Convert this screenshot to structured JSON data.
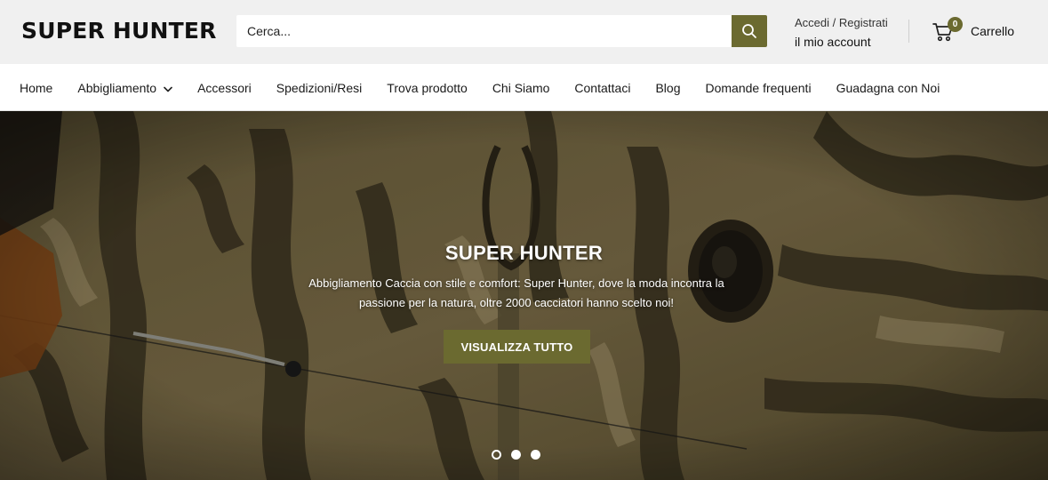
{
  "header": {
    "logo": "SUPER HUNTER",
    "search": {
      "placeholder": "Cerca..."
    },
    "account": {
      "line1": "Accedi / Registrati",
      "line2": "il mio account"
    },
    "cart": {
      "count": "0",
      "label": "Carrello"
    }
  },
  "nav": {
    "items": [
      {
        "label": "Home"
      },
      {
        "label": "Abbigliamento"
      },
      {
        "label": "Accessori"
      },
      {
        "label": "Spedizioni/Resi"
      },
      {
        "label": "Trova prodotto"
      },
      {
        "label": "Chi Siamo"
      },
      {
        "label": "Contattaci"
      },
      {
        "label": "Blog"
      },
      {
        "label": "Domande frequenti"
      },
      {
        "label": "Guadagna con Noi"
      }
    ]
  },
  "hero": {
    "title": "SUPER HUNTER",
    "subtitle": "Abbigliamento Caccia con stile e comfort: Super Hunter, dove la moda incontra la passione per la natura, oltre 2000 cacciatori hanno scelto noi!",
    "button": "VISUALIZZA TUTTO",
    "slides": {
      "count": 3,
      "active": 1
    }
  },
  "colors": {
    "accent": "#6b6a30",
    "header_bg": "#f0f0f0"
  },
  "icons": {
    "search": "search-icon",
    "cart": "cart-icon",
    "dropdown": "chevron-down-icon"
  }
}
